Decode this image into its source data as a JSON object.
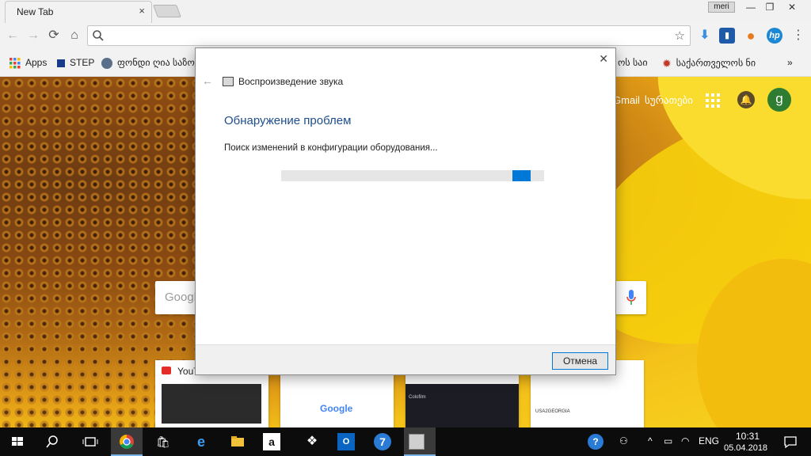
{
  "browser": {
    "tab_title": "New Tab",
    "tab_close": "×",
    "profile_name": "meri",
    "window_controls": {
      "minimize": "—",
      "restore": "❐",
      "close": "✕"
    }
  },
  "toolbar": {
    "back_icon": "←",
    "forward_icon": "→",
    "reload_icon": "⟳",
    "home_icon": "⌂",
    "omnibox_value": "",
    "star_icon": "☆",
    "extensions": [
      {
        "name": "download-extension",
        "glyph": "⬇",
        "color": "#3d8fe0"
      },
      {
        "name": "bookmark-extension",
        "glyph": "▮",
        "color": "#1f5aa8"
      },
      {
        "name": "basketball-extension",
        "glyph": "●",
        "color": "#e67a1e"
      },
      {
        "name": "hp-extension",
        "glyph": "hp",
        "color": "#1c88d4"
      }
    ],
    "menu_icon": "⋮"
  },
  "bookmarks": {
    "apps": "Apps",
    "step": "STEP",
    "fund": "ფონდი ღია საზოგ",
    "item_right1": "ოს საი",
    "item_right2": "საქართველოს ნი",
    "overflow": "»"
  },
  "ntp": {
    "gmail": "Gmail",
    "images": "სურათები",
    "avatar_letter": "g",
    "search_placeholder": "Google",
    "tiles": [
      {
        "label": "YouTube"
      },
      {
        "label": "Google"
      },
      {
        "label": "Colofilm"
      },
      {
        "label": "USA2GEORGIA"
      }
    ]
  },
  "dialog": {
    "app_title": "Воспроизведение звука",
    "heading": "Обнаружение проблем",
    "status": "Поиск изменений в конфигурации оборудования...",
    "progress_fraction": 0.07,
    "progress_offset_fraction": 0.88,
    "cancel": "Отмена",
    "close": "✕",
    "back": "←"
  },
  "taskbar": {
    "language": "ENG",
    "time": "10:31",
    "date": "05.04.2018",
    "items": [
      "start",
      "search",
      "task-view",
      "chrome",
      "store",
      "edge",
      "explorer",
      "amazon",
      "dropbox",
      "outlook",
      "unknown-app",
      "troubleshooter"
    ]
  }
}
